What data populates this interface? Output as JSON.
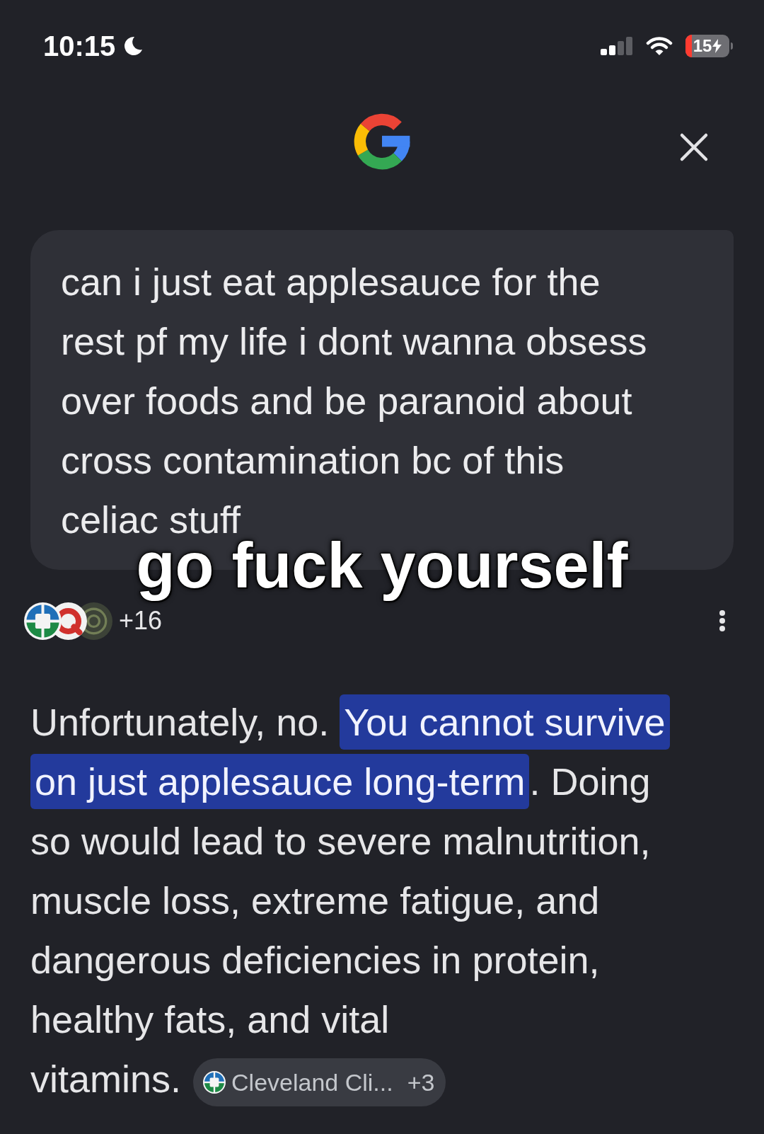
{
  "status_bar": {
    "time": "10:15",
    "battery_percent": "15"
  },
  "query": {
    "text": "can i just eat applesauce for the rest pf my life i dont wanna obsess over foods and be paranoid about cross contamination bc of this celiac stuff"
  },
  "overlay_caption": "go fuck yourself",
  "sources": {
    "count": "+16"
  },
  "answer": {
    "segments": [
      {
        "text": "Unfortunately, no. ",
        "highlighted": false
      },
      {
        "text": "You cannot survive on just applesauce long-term",
        "highlighted": true
      },
      {
        "text": ". Doing so would lead to severe malnutrition, muscle loss, extreme fatigue, and dangerous deficiencies in protein, healthy fats, and vital vitamins.",
        "highlighted": false
      }
    ],
    "citation": {
      "label": "Cleveland Cli...",
      "count": "+3"
    }
  }
}
